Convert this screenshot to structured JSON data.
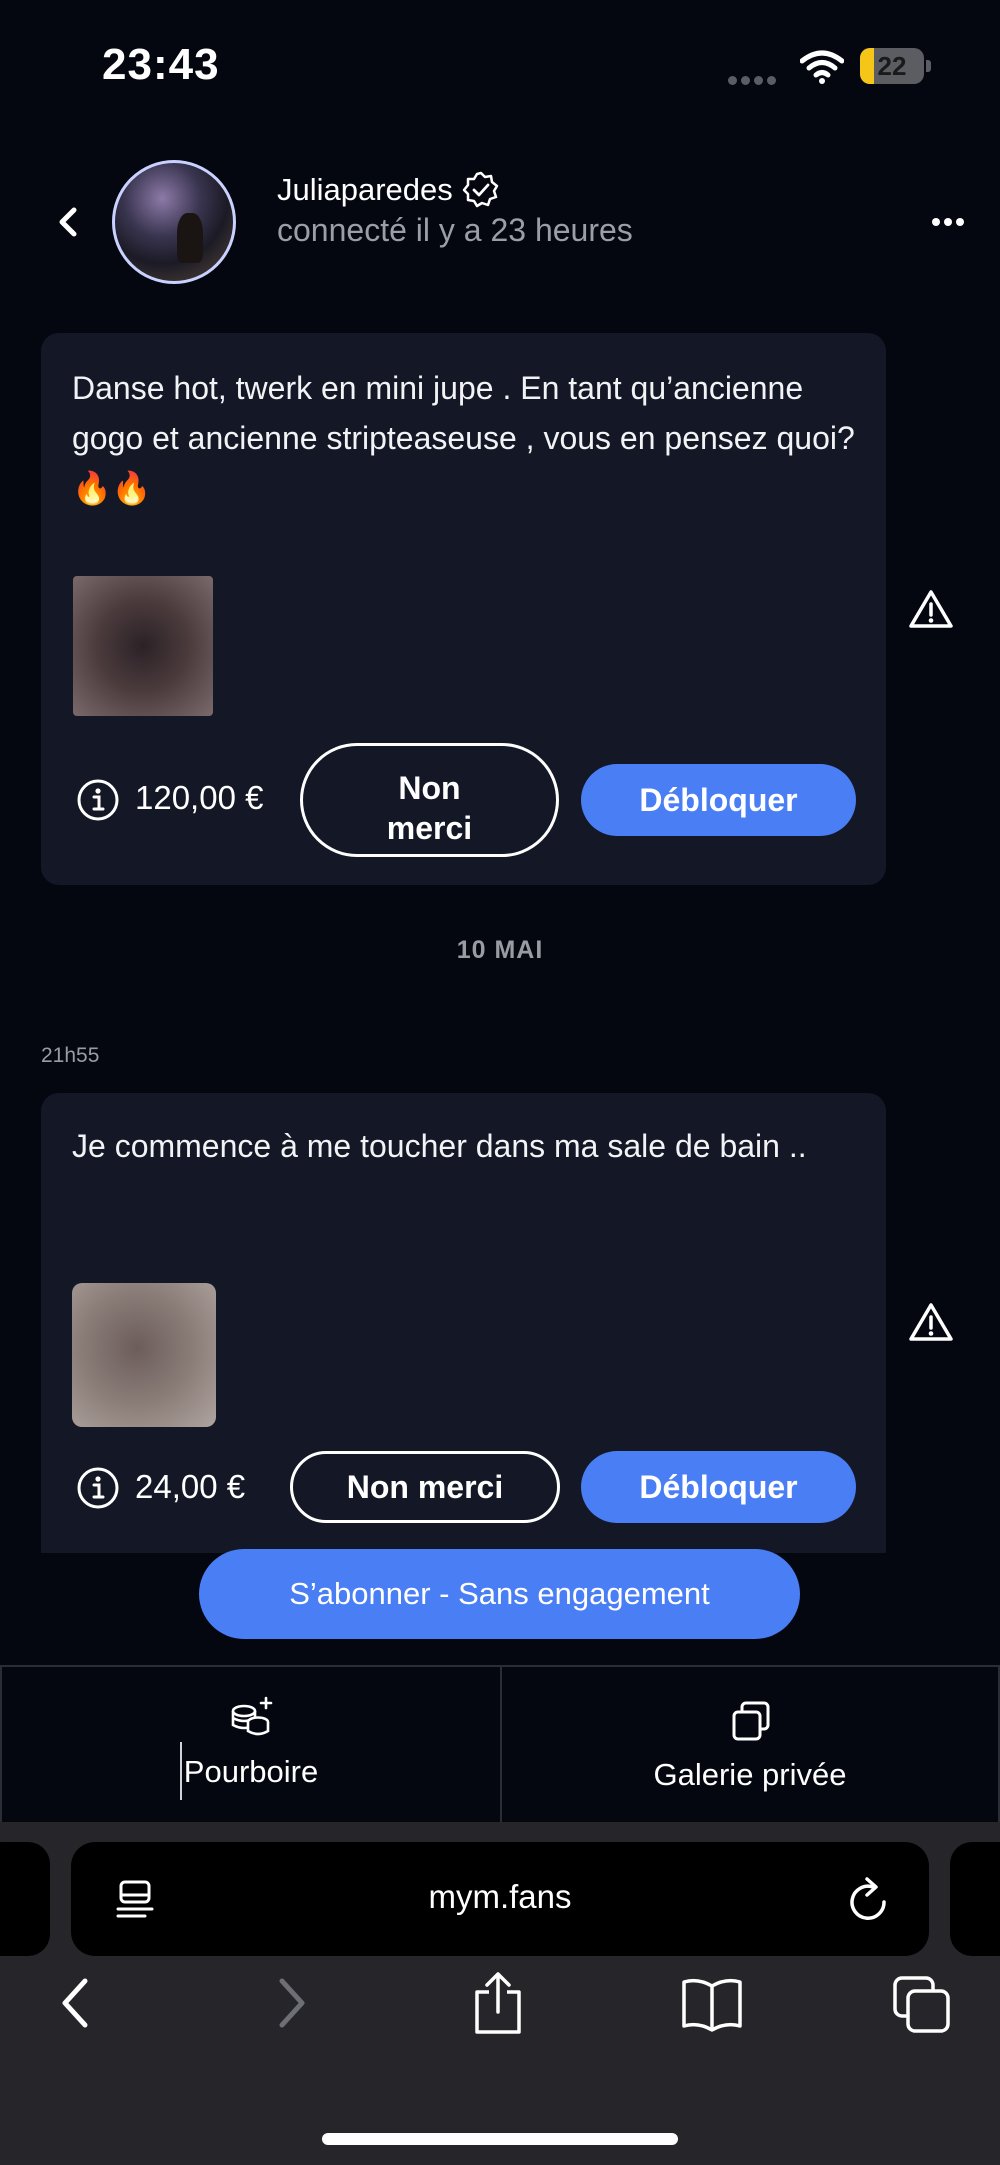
{
  "status_bar": {
    "time": "23:43",
    "battery_level": "22",
    "battery_fraction": 0.22,
    "battery_color": "#f5c518"
  },
  "chat_header": {
    "user_name": "Juliaparedes",
    "user_status": "connecté il y a 23 heures",
    "icons": [
      "back-icon",
      "verified-icon",
      "more-icon"
    ]
  },
  "messages": [
    {
      "text": "Danse hot, twerk en mini jupe . En tant qu’ancienne gogo et ancienne stripteaseuse , vous en pensez quoi? 🔥🔥",
      "price": "120,00 €",
      "decline_label": "Non merci",
      "unlock_label": "Débloquer"
    },
    {
      "time": "21h55",
      "text": "Je commence à me toucher dans ma sale de bain ..",
      "price": "24,00 €",
      "decline_label": "Non merci",
      "unlock_label": "Débloquer"
    }
  ],
  "date_separator": "10 MAI",
  "subscribe_label": "S’abonner - Sans engagement",
  "bottom_actions": {
    "tip_label": "Pourboire",
    "gallery_label": "Galerie privée"
  },
  "browser": {
    "url": "mym.fans"
  },
  "colors": {
    "accent": "#4a7ef5",
    "background": "#040710",
    "card": "#141826"
  }
}
